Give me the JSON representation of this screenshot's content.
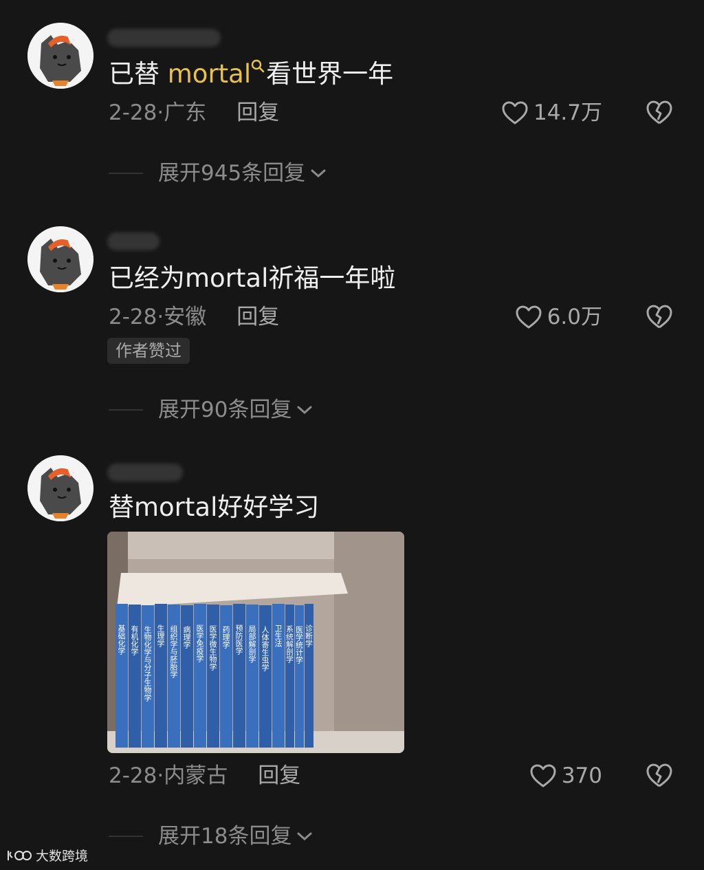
{
  "comments": [
    {
      "text_before": "已替 ",
      "keyword": "mortal",
      "text_after": "看世界一年",
      "date": "2-28",
      "location": "广东",
      "reply_label": "回复",
      "likes": "14.7万",
      "badge": "",
      "expand_label": "展开945条回复"
    },
    {
      "text": "已经为mortal祈福一年啦",
      "date": "2-28",
      "location": "安徽",
      "reply_label": "回复",
      "likes": "6.0万",
      "badge": "作者赞过",
      "expand_label": "展开90条回复"
    },
    {
      "text": "替mortal好好学习",
      "date": "2-28",
      "location": "内蒙古",
      "reply_label": "回复",
      "likes": "370",
      "badge": "",
      "expand_label": "展开18条回复",
      "book_titles": [
        "基础化学",
        "有机化学",
        "生物化学与分子生物学",
        "生理学",
        "组织学与胚胎学",
        "病理学",
        "医学免疫学",
        "医学微生物学",
        "药理学",
        "预防医学",
        "局部解剖学",
        "人体寄生虫学",
        "卫生法",
        "系统解剖学",
        "医学统计学",
        "诊断学"
      ]
    }
  ],
  "watermark": "大数跨境",
  "icons": {
    "like": "heart-outline-icon",
    "dislike": "broken-heart-icon",
    "search_keyword": "search-icon",
    "expand": "chevron-down-icon"
  },
  "colors": {
    "background": "#161616",
    "keyword": "#e8c24a",
    "meta": "#8c8c8c"
  }
}
